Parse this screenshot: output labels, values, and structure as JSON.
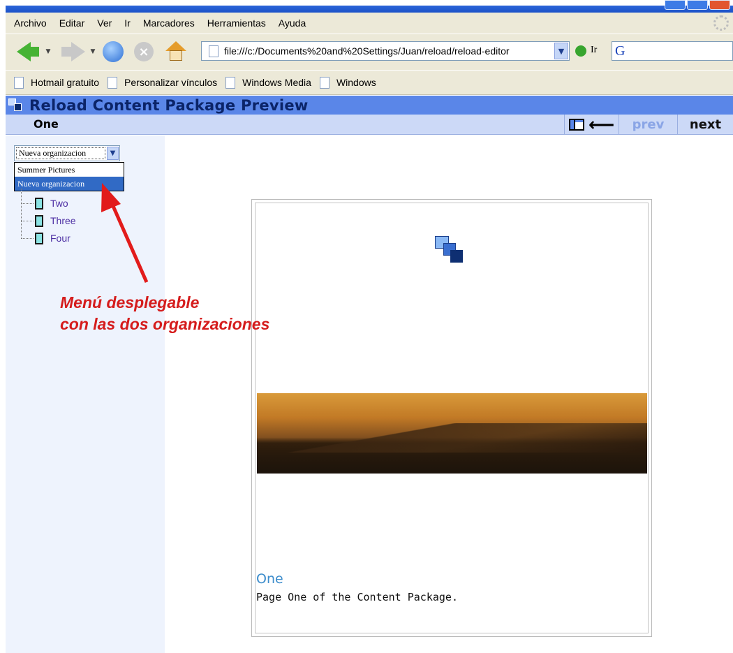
{
  "browser": {
    "menu": [
      "Archivo",
      "Editar",
      "Ver",
      "Ir",
      "Marcadores",
      "Herramientas",
      "Ayuda"
    ],
    "address": "file:///c:/Documents%20and%20Settings/Juan/reload/reload-editor",
    "go_label": "Ir",
    "search_icon": "G",
    "bookmarks": [
      "Hotmail gratuito",
      "Personalizar vínculos",
      "Windows Media",
      "Windows"
    ]
  },
  "preview": {
    "title": "Reload Content Package Preview",
    "current_page": "One",
    "prev_label": "prev",
    "next_label": "next",
    "toggle_arrow": "⟵"
  },
  "tree": {
    "selected_org": "Nueva organizacion",
    "org_options": [
      "Summer Pictures",
      "Nueva organizacion"
    ],
    "items": [
      "Two",
      "Three",
      "Four"
    ]
  },
  "annotation": {
    "line1": "Menú desplegable",
    "line2": "con las dos organizaciones",
    "color": "#d51c1c"
  },
  "content": {
    "heading": "One",
    "text": "Page One of the Content Package."
  },
  "colors": {
    "header_bg": "#5a86e8",
    "pagebar_bg": "#ccd9f7",
    "tree_link": "#4c2ea3"
  }
}
